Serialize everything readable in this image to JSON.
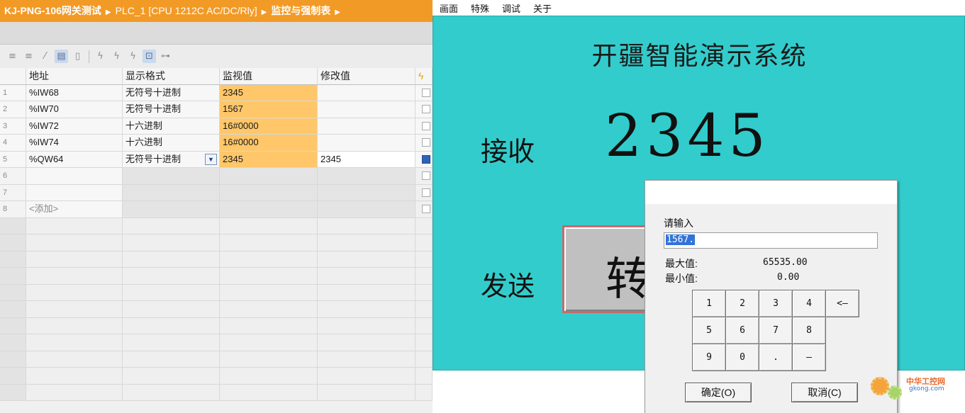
{
  "breadcrumb": {
    "project": "KJ-PNG-106网关测试",
    "device": "PLC_1 [CPU 1212C AC/DC/Rly]",
    "table": "监控与强制表"
  },
  "watch_table": {
    "headers": {
      "address": "地址",
      "format": "显示格式",
      "monitor": "监视值",
      "modify": "修改值"
    },
    "rows": [
      {
        "num": "1",
        "address": "%IW68",
        "format": "无符号十进制",
        "monitor": "2345",
        "modify": "",
        "checked": false
      },
      {
        "num": "2",
        "address": "%IW70",
        "format": "无符号十进制",
        "monitor": "1567",
        "modify": "",
        "checked": false
      },
      {
        "num": "3",
        "address": "%IW72",
        "format": "十六进制",
        "monitor": "16#0000",
        "modify": "",
        "checked": false
      },
      {
        "num": "4",
        "address": "%IW74",
        "format": "十六进制",
        "monitor": "16#0000",
        "modify": "",
        "checked": false
      },
      {
        "num": "5",
        "address": "%QW64",
        "format": "无符号十进制",
        "monitor": "2345",
        "modify": "2345",
        "checked": true
      },
      {
        "num": "6",
        "address": "",
        "format": "",
        "monitor": "",
        "modify": "",
        "checked": false
      },
      {
        "num": "7",
        "address": "",
        "format": "",
        "monitor": "",
        "modify": "",
        "checked": false
      },
      {
        "num": "8",
        "address": "<添加>",
        "format": "",
        "monitor": "",
        "modify": "",
        "checked": false
      }
    ]
  },
  "hmi": {
    "menu": [
      "画面",
      "特殊",
      "调试",
      "关于"
    ],
    "title": "开疆智能演示系统",
    "receive_label": "接收",
    "receive_value": "2345",
    "send_label": "发送",
    "send_value_partial": "转"
  },
  "dialog": {
    "prompt": "请输入",
    "input_value": "1567.",
    "max_label": "最大值:",
    "max_value": "65535.00",
    "min_label": "最小值:",
    "min_value": "0.00",
    "keys": [
      "1",
      "2",
      "3",
      "4",
      "<—",
      "5",
      "6",
      "7",
      "8",
      "",
      "9",
      "0",
      ".",
      "—",
      ""
    ],
    "ok_label": "确定(O)",
    "cancel_label": "取消(C)"
  },
  "watermark": {
    "text": "中华工控网",
    "url": "gkong.com"
  }
}
